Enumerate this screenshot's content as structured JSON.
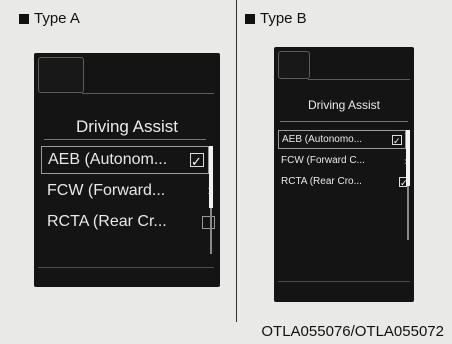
{
  "type_a": {
    "label": "Type A",
    "title": "Driving Assist",
    "items": [
      {
        "label": "AEB (Autonom...",
        "control": "checkbox",
        "checked": true,
        "selected": true
      },
      {
        "label": "FCW (Forward...",
        "control": "chevron",
        "checked": false,
        "selected": false
      },
      {
        "label": "RCTA (Rear Cr...",
        "control": "checkbox",
        "checked": false,
        "selected": false
      }
    ]
  },
  "type_b": {
    "label": "Type B",
    "title": "Driving Assist",
    "items": [
      {
        "label": "AEB (Autonomo...",
        "control": "checkbox",
        "checked": true,
        "selected": true
      },
      {
        "label": "FCW (Forward C...",
        "control": "chevron",
        "checked": false,
        "selected": false
      },
      {
        "label": "RCTA (Rear Cro...",
        "control": "checkbox",
        "checked": true,
        "selected": false
      }
    ]
  },
  "caption": "OTLA055076/OTLA055072",
  "icons": {
    "bullet": "black-square-icon",
    "check": "check-icon",
    "chevron": "chevron-right-icon"
  },
  "colors": {
    "background": "#e9e9e7",
    "screen": "#141414",
    "text": "#ececec"
  }
}
